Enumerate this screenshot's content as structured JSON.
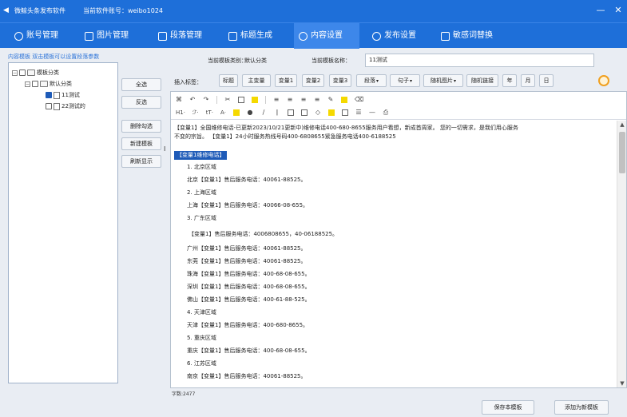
{
  "titlebar": {
    "title": "微鲸头条发布软件",
    "account": "当前软件账号：weibo1024",
    "minimize": "—",
    "close": "✕"
  },
  "nav": {
    "tabs": [
      {
        "label": "账号管理",
        "active": false
      },
      {
        "label": "图片管理",
        "active": false
      },
      {
        "label": "段落管理",
        "active": false
      },
      {
        "label": "标题生成",
        "active": false
      },
      {
        "label": "内容设置",
        "active": true
      },
      {
        "label": "发布设置",
        "active": false
      },
      {
        "label": "敏感词替换",
        "active": false
      }
    ]
  },
  "left": {
    "hint": "内容模板 双击模板可以设置段落参数",
    "tree": {
      "root": "模板分类",
      "category": "默认分类",
      "items": [
        {
          "label": "11测试",
          "checked": true
        },
        {
          "label": "22测试的",
          "checked": false
        }
      ]
    }
  },
  "side_buttons": {
    "select_all": "全选",
    "invert": "反选",
    "delete_checked": "删除勾选",
    "new_template": "新建模板",
    "refresh": "刷新显示"
  },
  "fields": {
    "category_label": "当前模板类别：",
    "category_value": "默认分类",
    "name_label": "当前模板名称：",
    "name_value": "11测试"
  },
  "insert": {
    "label": "插入标签：",
    "buttons": [
      {
        "label": "标题",
        "dropdown": false
      },
      {
        "label": "主变量",
        "dropdown": false
      },
      {
        "label": "变量1",
        "dropdown": false
      },
      {
        "label": "变量2",
        "dropdown": false
      },
      {
        "label": "变量3",
        "dropdown": false
      },
      {
        "label": "段落",
        "dropdown": true
      },
      {
        "label": "句子",
        "dropdown": true
      },
      {
        "label": "随机图片",
        "dropdown": true
      },
      {
        "label": "随机链接",
        "dropdown": false
      },
      {
        "label": "年",
        "dropdown": false
      },
      {
        "label": "月",
        "dropdown": false
      },
      {
        "label": "日",
        "dropdown": false
      }
    ]
  },
  "editor": {
    "toolbar_text": {
      "heading": "H1·",
      "font": "ℱ·",
      "size": "tT·",
      "color": "A·"
    },
    "intro_line1": "【变量1】全国维修电话-已更新2023/10/21更新中)维修电话400-680-8655服务用户看想，新成首周家。 您的一切需求，是我们用心服务",
    "intro_line2": "不变的宗旨。         【变量1】24小时服务热线号码400-6808655紧急服务电话400-6188525",
    "badge": "【变量1维修电话】",
    "lines": [
      {
        "text": "1. 北京区域",
        "style": "indent"
      },
      {
        "text": "北京【变量1】售后服务电话：40061-88525。",
        "style": "indent"
      },
      {
        "text": "2. 上海区域",
        "style": "indent"
      },
      {
        "text": "上海【变量1】售后服务电话：40066-08-655。",
        "style": "indent"
      },
      {
        "text": "3. 广东区域",
        "style": "indent"
      },
      {
        "text": "【变量1】售后服务电话：4006808655，40-06188525。",
        "style": "indent2"
      },
      {
        "text": "广州【变量1】售后服务电话：40061-88525。",
        "style": "indent"
      },
      {
        "text": "东莞【变量1】售后服务电话：40061-88525。",
        "style": "indent"
      },
      {
        "text": "珠海【变量1】售后服务电话：400-68-08-655。",
        "style": "indent"
      },
      {
        "text": "深圳【变量1】售后服务电话：400-68-08-655。",
        "style": "indent"
      },
      {
        "text": "佛山【变量1】售后服务电话：400-61-88-525。",
        "style": "indent"
      },
      {
        "text": "4. 天津区域",
        "style": "indent"
      },
      {
        "text": "天津【变量1】售后服务电话：400-680-8655。",
        "style": "indent"
      },
      {
        "text": "5. 重庆区域",
        "style": "indent"
      },
      {
        "text": "重庆【变量1】售后服务电话：400-68-08-655。",
        "style": "indent"
      },
      {
        "text": "6. 江苏区域",
        "style": "indent"
      },
      {
        "text": "南京【变量1】售后服务电话：40061-88525。",
        "style": "indent"
      }
    ]
  },
  "char_count": "字数:2477",
  "bottom": {
    "save": "保存本模板",
    "add_new": "添加为新模板"
  }
}
